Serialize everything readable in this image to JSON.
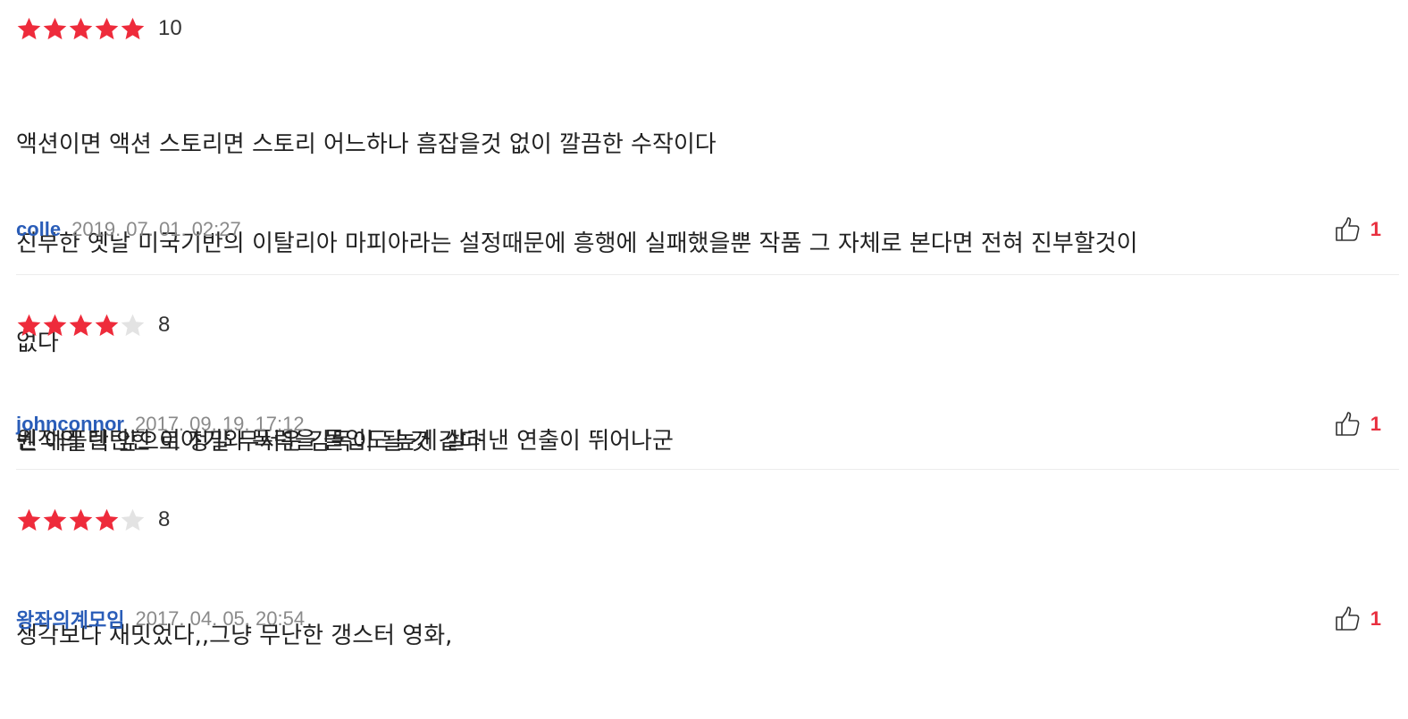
{
  "colors": {
    "star_filled": "#ee2b3b",
    "star_empty": "#e3e3e3",
    "author": "#2a5db8",
    "date": "#8a8a8a",
    "like_count": "#e8303f"
  },
  "reviews": [
    {
      "rating": 10,
      "stars_filled": 5,
      "stars_total": 5,
      "score": "10",
      "comment_lines": [
        "액션이면 액션 스토리면 스토리 어느하나 흠잡을것 없이 깔끔한 수작이다",
        "진부한 옛날 미국기반의 이탈리아 마피아라는 설정때문에 흥행에 실패했을뿐 작품 그 자체로 본다면 전혀 진부할것이",
        "없다",
        "벤 애플렉 앞으로 정말 무서운 감독이 될 것 같다"
      ],
      "author": "colle",
      "date": "2019. 07. 01. 02:27",
      "likes": "1",
      "like_icon": "thumbs-up-icon"
    },
    {
      "rating": 8,
      "stars_filled": 4,
      "stars_total": 5,
      "score": "8",
      "comment_lines": [
        "원작의 탄탄한 이야기와 폭력을 몰입도 높게 살려낸 연출이 뛰어나군"
      ],
      "author": "johnconnor",
      "date": "2017. 09. 19. 17:12",
      "likes": "1",
      "like_icon": "thumbs-up-icon"
    },
    {
      "rating": 8,
      "stars_filled": 4,
      "stars_total": 5,
      "score": "8",
      "comment_lines": [
        "생각보다 재밋었다,,그냥 무난한 갱스터 영화,"
      ],
      "author": "왕좌의계모임",
      "date": "2017. 04. 05. 20:54",
      "likes": "1",
      "like_icon": "thumbs-up-icon"
    }
  ]
}
